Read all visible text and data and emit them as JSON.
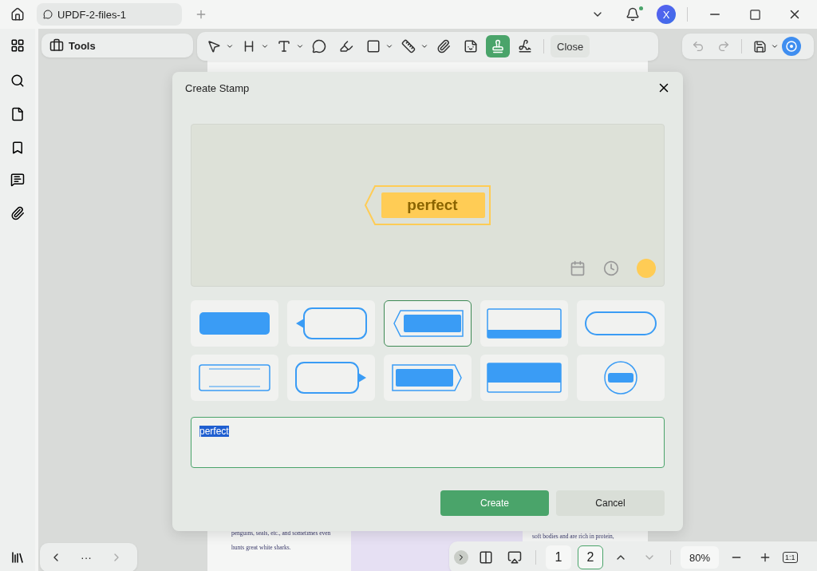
{
  "tab": {
    "title": "UPDF-2-files-1"
  },
  "account": {
    "initial": "X"
  },
  "notifications": {
    "unread": true
  },
  "tools_button": {
    "label": "Tools"
  },
  "toolbar": {
    "tools": [
      {
        "kind": "pointer",
        "dropdown": true,
        "selected": false
      },
      {
        "kind": "heading",
        "dropdown": true,
        "selected": false
      },
      {
        "kind": "text",
        "dropdown": true,
        "selected": false
      },
      {
        "kind": "comment",
        "dropdown": false,
        "selected": false
      },
      {
        "kind": "highlight",
        "dropdown": false,
        "selected": false
      },
      {
        "kind": "shape",
        "dropdown": true,
        "selected": false
      },
      {
        "kind": "measure",
        "dropdown": true,
        "selected": false
      },
      {
        "kind": "attach",
        "dropdown": false,
        "selected": false
      },
      {
        "kind": "sticker",
        "dropdown": false,
        "selected": false
      },
      {
        "kind": "stamp",
        "dropdown": false,
        "selected": true
      },
      {
        "kind": "signature",
        "dropdown": false,
        "selected": false
      }
    ],
    "close": "Close"
  },
  "document": {
    "left_text": "penguins, seals, etc., and sometimes even hunts great white sharks.",
    "right_text": "soft bodies and are rich in protein,"
  },
  "dialog": {
    "title": "Create Stamp",
    "preview": {
      "text": "perfect",
      "color": "#ffcc55"
    },
    "styles": [
      {
        "kind": "filled-plate",
        "selected": false
      },
      {
        "kind": "callout-left",
        "selected": false
      },
      {
        "kind": "framed-callout-left",
        "selected": true
      },
      {
        "kind": "bottom-band",
        "selected": false
      },
      {
        "kind": "pill",
        "selected": false
      },
      {
        "kind": "outline-plate",
        "selected": false
      },
      {
        "kind": "callout-right",
        "selected": false
      },
      {
        "kind": "framed-callout-right",
        "selected": false
      },
      {
        "kind": "top-band",
        "selected": false
      },
      {
        "kind": "circle",
        "selected": false
      }
    ],
    "input": {
      "value": "perfect",
      "text_selected": true
    },
    "buttons": [
      {
        "label": "Create",
        "kind": "primary"
      },
      {
        "label": "Cancel",
        "kind": "secondary"
      }
    ]
  },
  "nav": {
    "more": "···"
  },
  "pager": {
    "pages": [
      {
        "label": "1",
        "selected": false
      },
      {
        "label": "2",
        "selected": true
      }
    ],
    "zoom": "80%",
    "fit": "1:1"
  }
}
